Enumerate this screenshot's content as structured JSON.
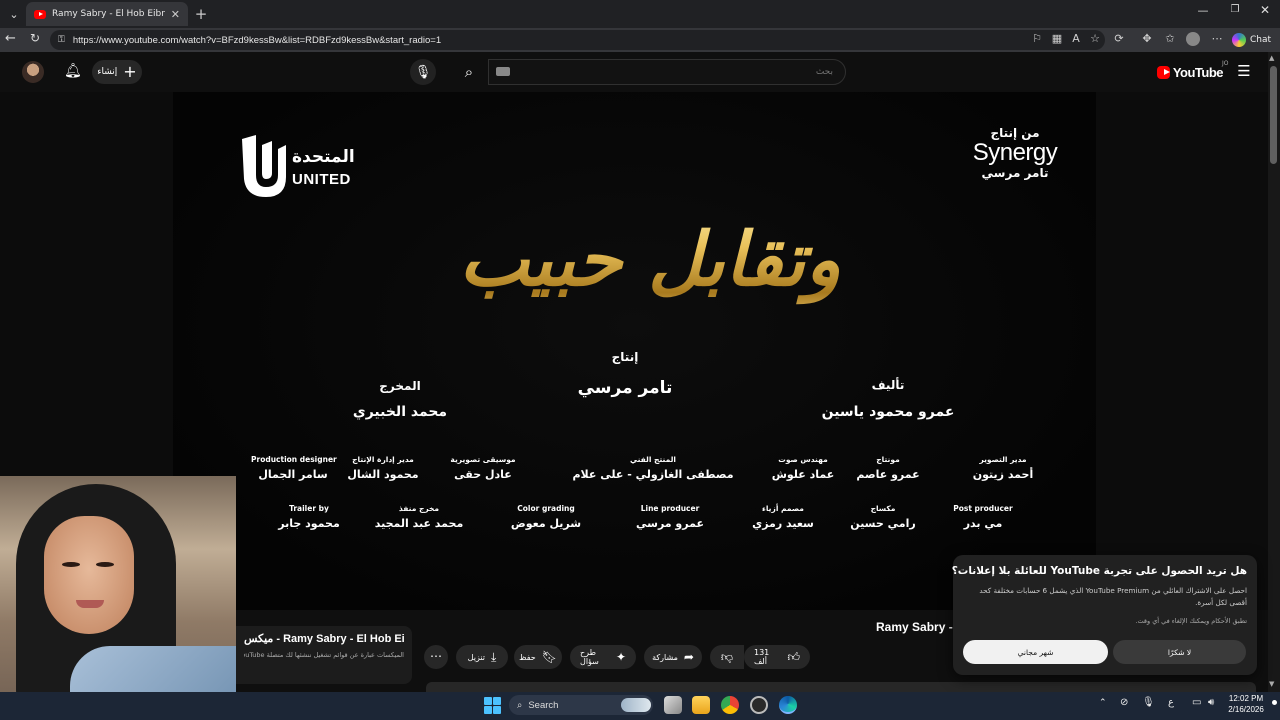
{
  "browser": {
    "tab_title": "Ramy Sabry - El Hob Eibna | رامي صبري - الحب",
    "url": "https://www.youtube.com/watch?v=BFzd9kessBw&list=RDBFzd9kessBw&start_radio=1",
    "chat_label": "Chat"
  },
  "youtube": {
    "create_label": "إنشاء",
    "search_placeholder": "بحث",
    "logo_text": "YouTube",
    "country_code": "JO"
  },
  "video_frame": {
    "title_art": "وتقابل حبيب",
    "united_ar": "المتحدة",
    "united_en": "UNITED",
    "synergy_from": "من إنتاج",
    "synergy_name": "Synergy",
    "synergy_owner": "تامر مرسي",
    "production_role": "إنتاج",
    "production_name": "تامر مرسي",
    "author_role": "تأليف",
    "author_name": "عمرو محمود ياسين",
    "director_role": "المخرج",
    "director_name": "محمد الخبيري",
    "credits_row1": [
      {
        "role": "مدير التصوير",
        "name": "أحمد زيتون"
      },
      {
        "role": "مونتاج",
        "name": "عمرو عاصم"
      },
      {
        "role": "مهندس صوت",
        "name": "عماد علوش"
      },
      {
        "role": "المنتج الفني",
        "name": "مصطفى الغازولي - على علام"
      },
      {
        "role": "موسيقى تصويرية",
        "name": "عادل حقى"
      },
      {
        "role": "مدير إدارة الإنتاج",
        "name": "محمود الشال"
      },
      {
        "role": "Production designer",
        "name": "سامر الجمال"
      }
    ],
    "credits_row2": [
      {
        "role": "Post producer",
        "name": "مي بدر"
      },
      {
        "role": "مكساج",
        "name": "رامي حسين"
      },
      {
        "role": "مصمم أزياء",
        "name": "سعيد رمزي"
      },
      {
        "role": "Line producer",
        "name": "عمرو مرسي"
      },
      {
        "role": "Color grading",
        "name": "شريل معوض"
      },
      {
        "role": "مخرج منفذ",
        "name": "محمد عبد المجيد"
      },
      {
        "role": "Trailer by",
        "name": "محمود جابر"
      }
    ]
  },
  "below_player": {
    "video_title": "Ramy Sabry - El Hob Eibna",
    "mix_title": "ميكس - Ramy Sabry - El Hob Eibna",
    "mix_subtitle": "الميكسات عبارة عن قوائم تشغيل ننشئها لك متصلة YouTube.",
    "like_count": "131 ألف",
    "share_label": "مشاركة",
    "ask_label": "طرح سؤال",
    "save_label": "حفظ",
    "download_label": "تنزيل"
  },
  "promo": {
    "title": "هل تريد الحصول على تجربة YouTube للعائلة بلا إعلانات؟",
    "body": "احصل على الاشتراك العائلي من YouTube Premium الذي يشمل 6 حسابات مختلفة كحد أقصى لكل أسرة.",
    "terms": "تطبق الأحكام ويمكنك الإلغاء في أي وقت.",
    "free_month": "شهر مجاني",
    "no_thanks": "لا شكرًا"
  },
  "taskbar": {
    "search_label": "Search",
    "time": "12:02 PM",
    "date": "2/16/2026",
    "lang": "ع"
  }
}
